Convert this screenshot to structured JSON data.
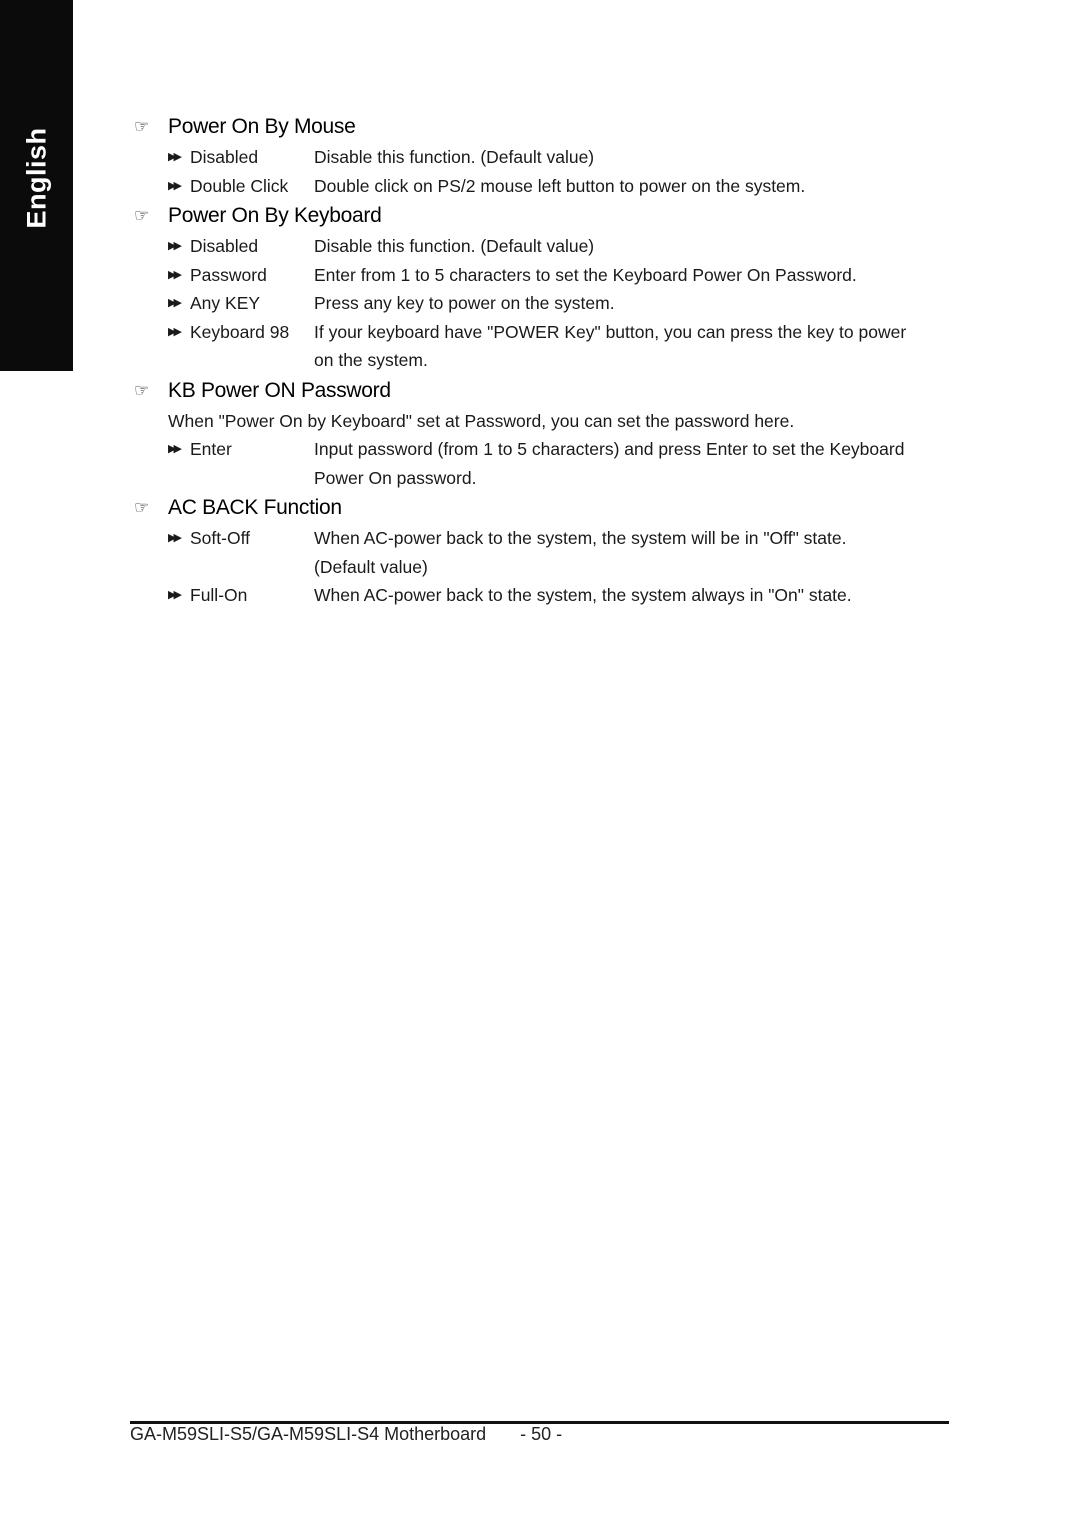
{
  "side_tab": {
    "label": "English"
  },
  "sections": [
    {
      "title": "Power On By Mouse",
      "icon": "pointing-hand-icon",
      "options": [
        {
          "name": "Disabled",
          "desc": [
            "Disable this function.  (Default value)"
          ]
        },
        {
          "name": "Double Click",
          "desc": [
            "Double click on PS/2 mouse left button to power on the system."
          ]
        }
      ]
    },
    {
      "title": "Power On By Keyboard",
      "icon": "pointing-hand-icon",
      "options": [
        {
          "name": "Disabled",
          "desc": [
            "Disable this function.  (Default value)"
          ]
        },
        {
          "name": "Password",
          "desc": [
            "Enter from 1 to 5 characters to set the Keyboard Power On Password."
          ]
        },
        {
          "name": "Any KEY",
          "desc": [
            "Press any key to power on the system."
          ]
        },
        {
          "name": "Keyboard 98",
          "desc": [
            "If your keyboard have \"POWER Key\" button, you can press the key to power",
            "on the system."
          ]
        }
      ]
    },
    {
      "title": "KB Power ON Password",
      "icon": "pointing-hand-icon",
      "note": "When \"Power On by Keyboard\" set at Password, you can set the password here.",
      "options": [
        {
          "name": "Enter",
          "desc": [
            "Input password (from 1 to 5 characters) and press Enter to set the Keyboard",
            "Power On password."
          ]
        }
      ]
    },
    {
      "title": "AC BACK Function",
      "icon": "pointing-hand-icon",
      "options": [
        {
          "name": "Soft-Off",
          "desc": [
            "When AC-power back to the system, the system will be in \"Off\" state.",
            "(Default value)"
          ]
        },
        {
          "name": "Full-On",
          "desc": [
            "When AC-power back to the system, the system always in \"On\" state."
          ]
        }
      ]
    }
  ],
  "footer": {
    "model": "GA-M59SLI-S5/GA-M59SLI-S4 Motherboard",
    "page": "- 50 -"
  }
}
